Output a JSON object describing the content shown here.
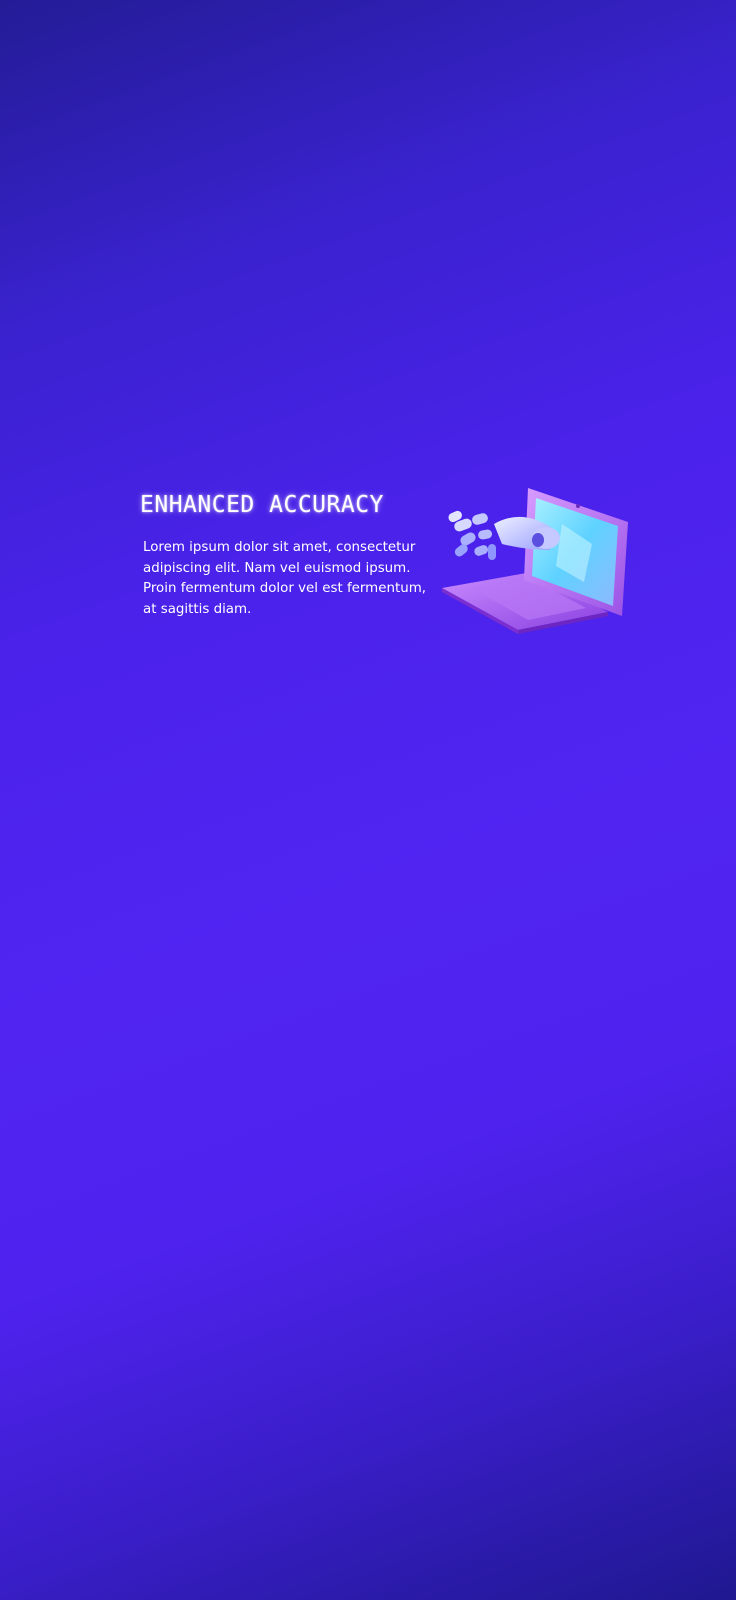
{
  "feature": {
    "title": "ENHANCED ACCURACY",
    "description": "Lorem ipsum dolor sit amet, consectetur adipiscing elit. Nam vel euismod ipsum. Proin fermentum dolor vel est fermentum, at sagittis diam.",
    "illustration_icon": "robot-hand-laptop-icon"
  },
  "colors": {
    "background_top": "#231c96",
    "background_mid": "#5124f2",
    "background_bottom": "#1f1890",
    "text": "#ffffff",
    "laptop_purple": "#b06cf0",
    "screen_cyan": "#7fe0ff"
  }
}
